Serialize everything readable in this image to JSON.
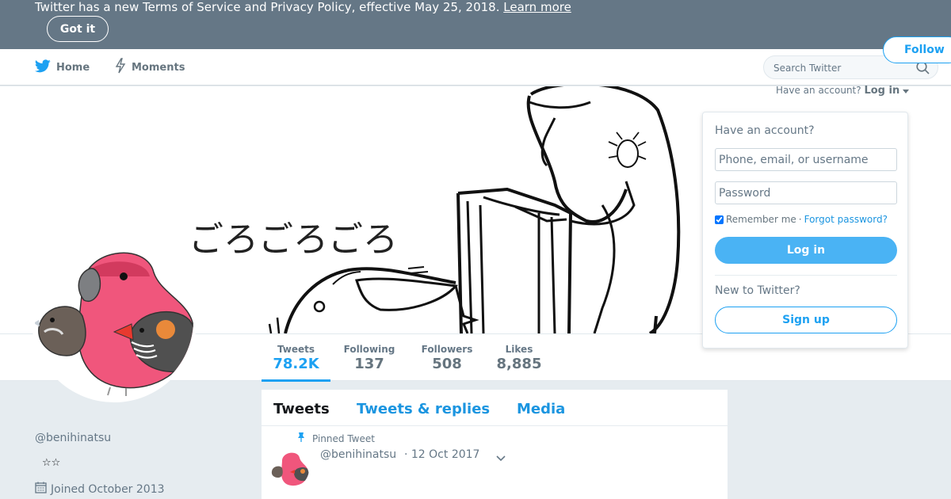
{
  "banner": {
    "text": "Twitter has a new Terms of Service and Privacy Policy, effective May 25, 2018.",
    "link_label": "Learn more",
    "got_it_label": "Got it"
  },
  "nav": {
    "home_label": "Home",
    "moments_label": "Moments",
    "search_placeholder": "Search Twitter"
  },
  "header": {
    "art_text": "ごろごろごろ"
  },
  "account_menu": {
    "prompt": "Have an account?",
    "login_label": "Log in"
  },
  "login_panel": {
    "title": "Have an account?",
    "username_placeholder": "Phone, email, or username",
    "password_placeholder": "Password",
    "remember_label": "Remember me",
    "separator": "·",
    "forgot_label": "Forgot password?",
    "login_button": "Log in",
    "new_prompt": "New to Twitter?",
    "signup_button": "Sign up"
  },
  "stats": [
    {
      "label": "Tweets",
      "value": "78.2K"
    },
    {
      "label": "Following",
      "value": "137"
    },
    {
      "label": "Followers",
      "value": "508"
    },
    {
      "label": "Likes",
      "value": "8,885"
    }
  ],
  "follow_label": "Follow",
  "profile": {
    "name": "",
    "handle": "@benihinatsu",
    "bio": "☆☆",
    "joined": "Joined October 2013"
  },
  "tabs": [
    "Tweets",
    "Tweets & replies",
    "Media"
  ],
  "tweet": {
    "pinned_label": "Pinned Tweet",
    "author": "@benihinatsu",
    "date": "· 12 Oct 2017"
  },
  "colors": {
    "brand": "#1da1f2",
    "banner": "#657786",
    "avatar_bird": "#f0567c"
  }
}
